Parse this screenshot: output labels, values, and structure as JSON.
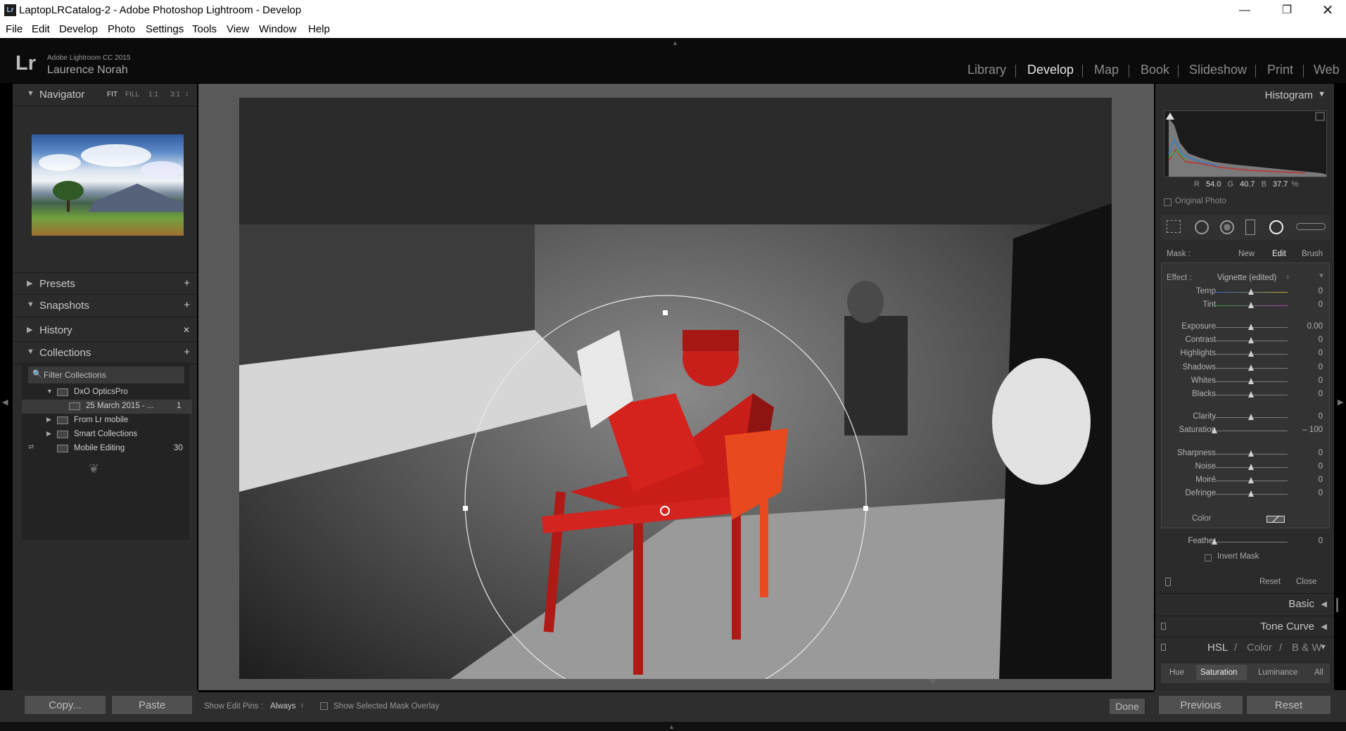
{
  "window": {
    "title": "LaptopLRCatalog-2 - Adobe Photoshop Lightroom - Develop",
    "app_badge": "Lr"
  },
  "menu": [
    "File",
    "Edit",
    "Develop",
    "Photo",
    "Settings",
    "Tools",
    "View",
    "Window",
    "Help"
  ],
  "identity": {
    "logo": "Lr",
    "version": "Adobe Lightroom CC 2015",
    "user": "Laurence Norah"
  },
  "modules": [
    "Library",
    "Develop",
    "Map",
    "Book",
    "Slideshow",
    "Print",
    "Web"
  ],
  "active_module": "Develop",
  "left": {
    "navigator": {
      "label": "Navigator",
      "zoom": [
        "FIT",
        "FILL",
        "1:1",
        "3:1"
      ],
      "zoom_arrow": "↕"
    },
    "presets": "Presets",
    "snapshots": "Snapshots",
    "history": "History",
    "collections": {
      "label": "Collections",
      "filter": "Filter Collections",
      "items": [
        {
          "name": "DxO OpticsPro",
          "count": ""
        },
        {
          "name": "25 March 2015 - ...",
          "count": "1"
        },
        {
          "name": "From Lr mobile",
          "count": ""
        },
        {
          "name": "Smart Collections",
          "count": ""
        },
        {
          "name": "Mobile Editing",
          "count": "30"
        }
      ]
    },
    "copy": "Copy...",
    "paste": "Paste"
  },
  "toolbar": {
    "show_edit_pins_label": "Show Edit Pins :",
    "show_edit_pins_value": "Always",
    "mask_overlay": "Show Selected Mask Overlay",
    "done": "Done"
  },
  "right": {
    "histogram": {
      "label": "Histogram",
      "readout": {
        "r_label": "R",
        "r": "54.0",
        "g_label": "G",
        "g": "40.7",
        "b_label": "B",
        "b": "37.7",
        "unit": "%"
      },
      "original_photo": "Original Photo"
    },
    "mask": {
      "label": "Mask :",
      "new": "New",
      "edit": "Edit",
      "brush": "Brush"
    },
    "effect": {
      "label": "Effect :",
      "value": "Vignette (edited)"
    },
    "sliders": [
      {
        "label": "Temp",
        "value": "0",
        "pos": 0.5
      },
      {
        "label": "Tint",
        "value": "0",
        "pos": 0.5
      },
      {
        "label": "Exposure",
        "value": "0.00",
        "pos": 0.5
      },
      {
        "label": "Contrast",
        "value": "0",
        "pos": 0.5
      },
      {
        "label": "Highlights",
        "value": "0",
        "pos": 0.5
      },
      {
        "label": "Shadows",
        "value": "0",
        "pos": 0.5
      },
      {
        "label": "Whites",
        "value": "0",
        "pos": 0.5
      },
      {
        "label": "Blacks",
        "value": "0",
        "pos": 0.5
      },
      {
        "label": "Clarity",
        "value": "0",
        "pos": 0.5
      },
      {
        "label": "Saturation",
        "value": "– 100",
        "pos": 0.0
      },
      {
        "label": "Sharpness",
        "value": "0",
        "pos": 0.5
      },
      {
        "label": "Noise",
        "value": "0",
        "pos": 0.5
      },
      {
        "label": "Moiré",
        "value": "0",
        "pos": 0.5
      },
      {
        "label": "Defringe",
        "value": "0",
        "pos": 0.5
      }
    ],
    "color_label": "Color",
    "feather": {
      "label": "Feather",
      "value": "0",
      "pos": 0.0
    },
    "invert_mask": "Invert Mask",
    "reset": "Reset",
    "close": "Close",
    "basic": "Basic",
    "tone_curve": "Tone Curve",
    "hsl": {
      "hsl": "HSL",
      "slash1": "/",
      "color": "Color",
      "slash2": "/",
      "bw": "B & W"
    },
    "hsl_tabs": [
      "Hue",
      "Saturation",
      "Luminance",
      "All"
    ],
    "previous": "Previous",
    "reset_btn": "Reset"
  },
  "colors": {
    "accent_red": "#d4211c",
    "panel": "#2b2b2b",
    "center": "#595959"
  }
}
